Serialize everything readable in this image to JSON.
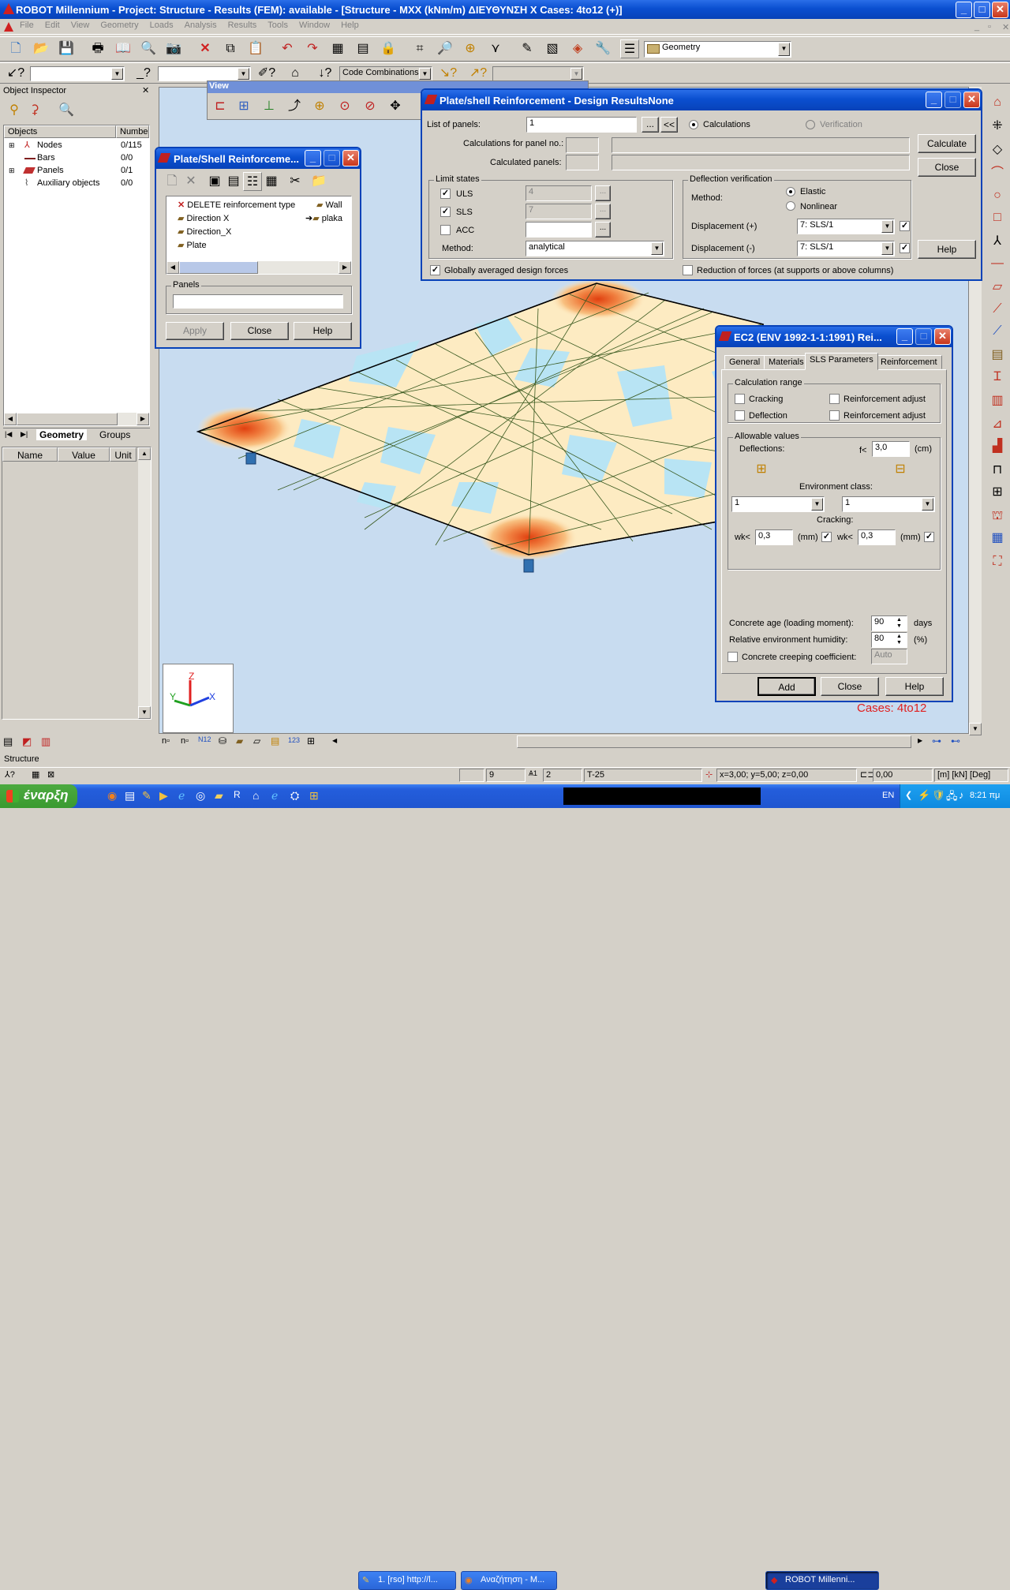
{
  "window": {
    "title": "ROBOT Millennium - Project: Structure - Results (FEM): available - [Structure - MXX (kNm/m) ΔΙΕΥΘΥΝΣΗ Χ Cases: 4to12  (+)]"
  },
  "menu": [
    "File",
    "Edit",
    "View",
    "Geometry",
    "Loads",
    "Analysis",
    "Results",
    "Tools",
    "Window",
    "Help"
  ],
  "toolbar": {
    "layout_value": "Geometry",
    "code_combinations": "Code Combinations"
  },
  "object_inspector": {
    "title": "Object Inspector",
    "col_objects": "Objects",
    "col_number": "Number",
    "rows": [
      {
        "label": "Nodes",
        "count": "0/115"
      },
      {
        "label": "Bars",
        "count": "0/0"
      },
      {
        "label": "Panels",
        "count": "0/1"
      },
      {
        "label": "Auxiliary objects",
        "count": "0/0"
      }
    ],
    "tab_geometry": "Geometry",
    "tab_groups": "Groups",
    "prop_name": "Name",
    "prop_value": "Value",
    "prop_unit": "Unit"
  },
  "view_toolbar": {
    "title": "View"
  },
  "plate_shell_small": {
    "title": "Plate/Shell Reinforceme...",
    "items": [
      "DELETE reinforcement type",
      "Direction X",
      "Direction_X",
      "Plate"
    ],
    "items_right": [
      "Wall",
      "plaka"
    ],
    "panels_label": "Panels",
    "apply": "Apply",
    "close": "Close",
    "help": "Help"
  },
  "design_results": {
    "title": "Plate/shell Reinforcement - Design ResultsNone",
    "list_of_panels_label": "List of panels:",
    "list_of_panels_value": "1",
    "browse": "...",
    "back": "<<",
    "calculations": "Calculations",
    "verification": "Verification",
    "calc_for_panel": "Calculations for panel no.:",
    "calculated_panels": "Calculated panels:",
    "calculate": "Calculate",
    "close": "Close",
    "help": "Help",
    "limit_states": "Limit states",
    "uls": "ULS",
    "uls_value": "4",
    "sls": "SLS",
    "sls_value": "7",
    "acc": "ACC",
    "method_label": "Method:",
    "method_value": "analytical",
    "deflection_verification": "Deflection verification",
    "def_method_label": "Method:",
    "elastic": "Elastic",
    "nonlinear": "Nonlinear",
    "disp_plus": "Displacement (+)",
    "disp_plus_value": "7: SLS/1",
    "disp_minus": "Displacement (-)",
    "disp_minus_value": "7: SLS/1",
    "globally_avg": "Globally averaged design forces",
    "reduction": "Reduction of forces (at supports or above columns)"
  },
  "ec2": {
    "title": "EC2 (ENV 1992-1-1:1991) Rei...",
    "tabs": [
      "General",
      "Materials",
      "SLS Parameters",
      "Reinforcement"
    ],
    "calc_range": "Calculation range",
    "cracking": "Cracking",
    "deflection": "Deflection",
    "reinf_adjust_1": "Reinforcement adjust",
    "reinf_adjust_2": "Reinforcement adjust",
    "allowable": "Allowable values",
    "deflections": "Deflections:",
    "f_lt": "f<",
    "f_value": "3,0",
    "f_unit": "(cm)",
    "env_class": "Environment class:",
    "env_left": "1",
    "env_right": "1",
    "cracking_label": "Cracking:",
    "wk_label": "wk<",
    "wk_left": "0,3",
    "wk_right": "0,3",
    "mm": "(mm)",
    "concrete_age": "Concrete age (loading moment):",
    "age_value": "90",
    "days": "days",
    "humidity": "Relative environment humidity:",
    "humidity_value": "80",
    "percent": "(%)",
    "creeping": "Concrete creeping coefficient:",
    "creeping_value": "Auto",
    "add": "Add",
    "close": "Close",
    "help": "Help"
  },
  "viewport": {
    "cases_label": "Cases: 4to12",
    "axis_x": "X",
    "axis_y": "Y",
    "axis_z": "Z"
  },
  "status": {
    "structure_tab": "Structure",
    "field_9": "9",
    "field_2": "2",
    "field_t25": "T-25",
    "coords": "x=3,00; y=5,00; z=0,00",
    "angle": "0,00",
    "units": "[m] [kN] [Deg]"
  },
  "taskbar": {
    "start": "έναρξη",
    "tasks": [
      "1. [rso] http://l...",
      "Αναζήτηση - M...",
      "ROBOT Millenni..."
    ],
    "lang": "EN",
    "clock": "8:21 πμ"
  }
}
